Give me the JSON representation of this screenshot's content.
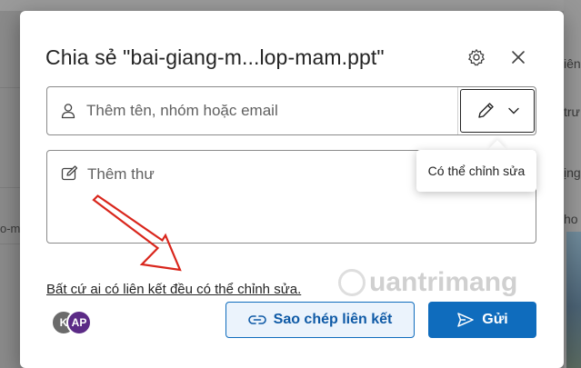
{
  "background": {
    "right_texts": [
      "iên",
      "trư",
      "ịng",
      "ho"
    ],
    "left_text": "o-m"
  },
  "dialog": {
    "title": "Chia sẻ \"bai-giang-m...lop-mam.ppt\"",
    "settings_icon": "gear-icon",
    "close_icon": "close-icon"
  },
  "people_field": {
    "placeholder": "Thêm tên, nhóm hoặc email",
    "value": "",
    "icon": "person-icon"
  },
  "permission": {
    "icon": "pencil-icon",
    "dropdown_icon": "chevron-down-icon",
    "tooltip": "Có thể chỉnh sửa"
  },
  "message_field": {
    "placeholder": "Thêm thư",
    "icon": "compose-icon"
  },
  "link_setting": "Bất cứ ai có liên kết đều có thể chỉnh sửa.",
  "avatars": [
    {
      "initials": "K",
      "color": "#6b6b6b"
    },
    {
      "initials": "AP",
      "color": "#5b2a86"
    }
  ],
  "buttons": {
    "copy_link": "Sao chép liên kết",
    "send": "Gửi"
  },
  "watermark": "uantrimang",
  "colors": {
    "accent": "#0f6cbd",
    "annotation_arrow": "#d9261c"
  }
}
